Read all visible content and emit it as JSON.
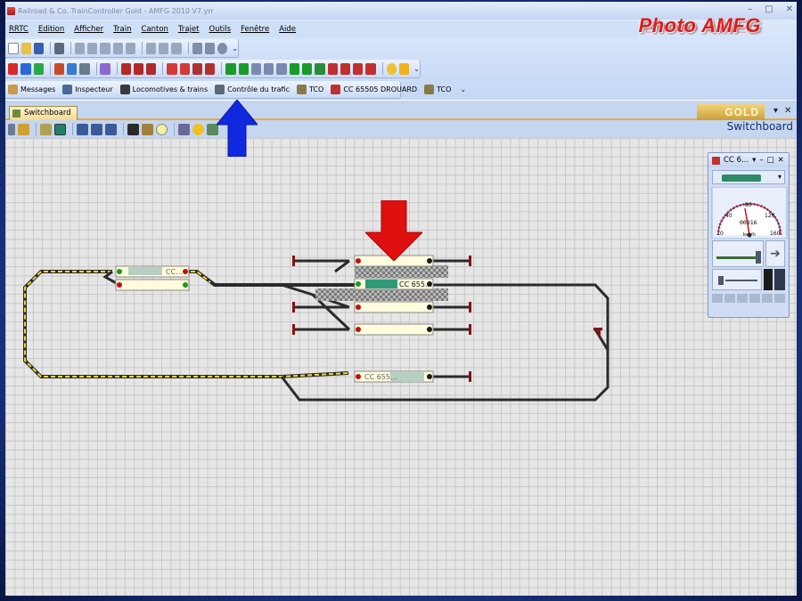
{
  "window": {
    "title": "Railroad & Co. TrainController Gold - AMFG 2010 V7.yrr"
  },
  "menu": [
    "RRTC",
    "Edition",
    "Afficher",
    "Train",
    "Canton",
    "Trajet",
    "Outils",
    "Fenêtre",
    "Aide"
  ],
  "toolbar3": {
    "items": [
      "Messages",
      "Inspecteur",
      "Locomotives & trains",
      "Contrôle du trafic",
      "TCO",
      "CC 65505 DROUARD",
      "TCO"
    ]
  },
  "logo": {
    "text": "Photo AMFG"
  },
  "document": {
    "tab_label": "Switchboard",
    "badge": "GOLD",
    "panel_title": "Switchboard"
  },
  "switchboard": {
    "blocks": [
      {
        "label": "CC..."
      },
      {
        "label": "CC 655..."
      },
      {
        "label": "CC 655..."
      }
    ]
  },
  "throttle": {
    "title": "CC 6...",
    "speed_value": "00316",
    "unit": "km/h",
    "ticks": [
      "0",
      "40",
      "80",
      "120",
      "160"
    ]
  },
  "colors": {
    "accent_red": "#e01010",
    "accent_blue": "#1028e0",
    "track": "#2b2b2b",
    "track_active": "#f0d830"
  }
}
